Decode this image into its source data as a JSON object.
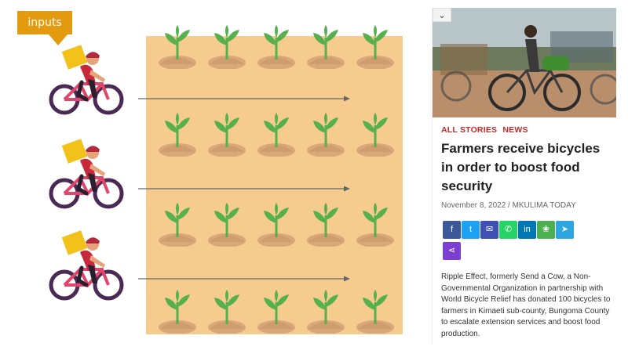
{
  "callout": {
    "label": "inputs",
    "color": "#e39a0e"
  },
  "field": {
    "color": "#f5cc8d",
    "rows": 4,
    "cols": 5
  },
  "article": {
    "categories": [
      "ALL STORIES",
      "NEWS"
    ],
    "headline": "Farmers receive bicycles in order to boost food security",
    "meta": "November 8, 2022 / MKULIMA TODAY",
    "share": [
      {
        "icon": "facebook-icon",
        "glyph": "f",
        "color": "#3b5998"
      },
      {
        "icon": "twitter-icon",
        "glyph": "t",
        "color": "#1da1f2"
      },
      {
        "icon": "email-icon",
        "glyph": "✉",
        "color": "#3f51b5"
      },
      {
        "icon": "whatsapp-icon",
        "glyph": "✆",
        "color": "#25d366"
      },
      {
        "icon": "linkedin-icon",
        "glyph": "in",
        "color": "#0077b5"
      },
      {
        "icon": "wechat-icon",
        "glyph": "❀",
        "color": "#4caf50"
      },
      {
        "icon": "telegram-icon",
        "glyph": "➤",
        "color": "#2ca5e0"
      },
      {
        "icon": "share-icon",
        "glyph": "⋖",
        "color": "#7b3fd3"
      }
    ],
    "body": "Ripple Effect, formerly Send a Cow, a Non-Governmental Organization in partnership with World Bicycle Relief has donated 100 bicycles to farmers in Kimaeti sub-county, Bungoma County to escalate extension services and boost food production."
  }
}
